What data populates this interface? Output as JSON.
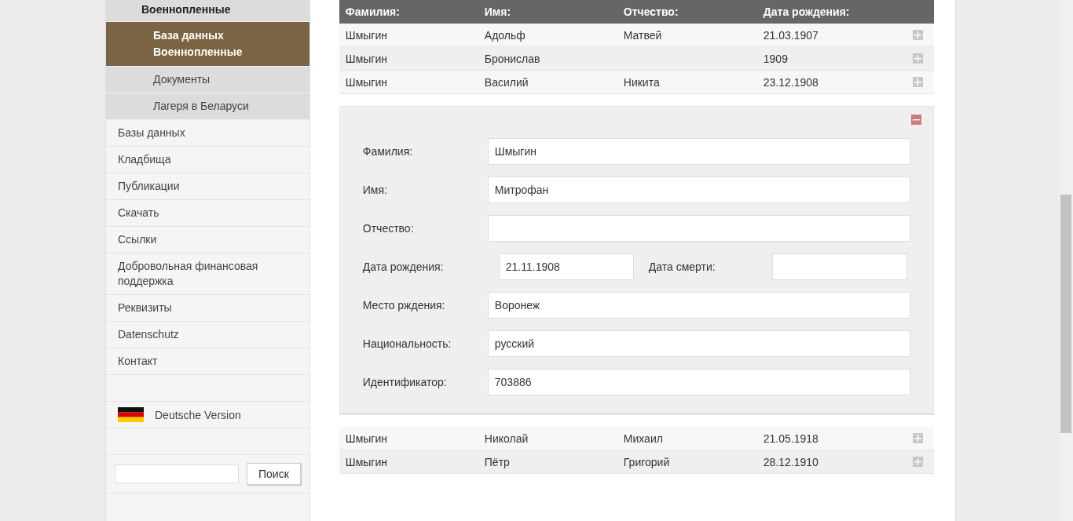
{
  "sidebar": {
    "items": [
      {
        "label": "Военнопленные",
        "expanded": true,
        "selected": false,
        "children": [
          {
            "label": "База данных Военнопленные",
            "selected": true
          },
          {
            "label": "Документы",
            "selected": false
          },
          {
            "label": "Лагеря в Беларуси",
            "selected": false
          }
        ]
      },
      {
        "label": "Базы данных",
        "selected": false
      },
      {
        "label": "Кладбища",
        "selected": false
      },
      {
        "label": "Публикации",
        "selected": false
      },
      {
        "label": "Скачать",
        "selected": false
      },
      {
        "label": "Ссылки",
        "selected": false
      },
      {
        "label": "Добровольная финансовая поддержка",
        "selected": false
      },
      {
        "label": "Реквизиты",
        "selected": false
      },
      {
        "label": "Datenschutz",
        "selected": false
      },
      {
        "label": "Контакт",
        "selected": false
      }
    ],
    "language_link": {
      "label": "Deutsche Version"
    },
    "search": {
      "button": "Поиск"
    }
  },
  "table": {
    "columns": [
      "Фамилия:",
      "Имя:",
      "Отчество:",
      "Дата рождения:"
    ],
    "rows": [
      {
        "cells": [
          "Шмыгин",
          "Адольф",
          "Матвей",
          "21.03.1907"
        ],
        "expanded": false
      },
      {
        "cells": [
          "Шмыгин",
          "Бронислав",
          null,
          "1909"
        ],
        "expanded": false
      },
      {
        "cells": [
          "Шмыгин",
          "Василий",
          "Никита",
          "23.12.1908"
        ],
        "expanded": false
      },
      {
        "expanded": true,
        "fields": [
          {
            "kind": "full",
            "label": "Фамилия:",
            "value": "Шмыгин"
          },
          {
            "kind": "full",
            "label": "Имя:",
            "value": "Митрофан"
          },
          {
            "kind": "full",
            "label": "Отчество:"
          },
          {
            "kind": "half",
            "label": "Дата рождения:",
            "value": "21.11.1908"
          },
          {
            "kind": "half",
            "label": "Дата смерти:"
          },
          {
            "kind": "full",
            "label": "Место рждения:",
            "value": "Воронеж"
          },
          {
            "kind": "full",
            "label": "Национальность:",
            "value": "русский"
          },
          {
            "kind": "full",
            "label": "Идентификатор:",
            "value": "703886"
          }
        ]
      },
      {
        "cells": [
          "Шмыгин",
          "Николай",
          "Михаил",
          "21.05.1918"
        ],
        "expanded": false
      },
      {
        "cells": [
          "Шмыгин",
          "Пётр",
          "Григорий",
          "28.12.1910"
        ],
        "expanded": false
      }
    ]
  }
}
